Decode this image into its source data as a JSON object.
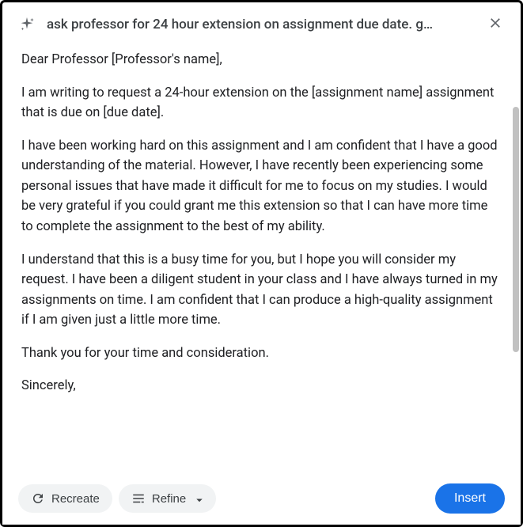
{
  "header": {
    "prompt": "ask professor for 24 hour extension on assignment due date. g…"
  },
  "content": {
    "greeting": "Dear Professor [Professor's name],",
    "para1": "I am writing to request a 24-hour extension on the [assignment name] assignment that is due on [due date].",
    "para2": "I have been working hard on this assignment and I am confident that I have a good understanding of the material. However, I have recently been experiencing some personal issues that have made it difficult for me to focus on my studies. I would be very grateful if you could grant me this extension so that I can have more time to complete the assignment to the best of my ability.",
    "para3": "I understand that this is a busy time for you, but I hope you will consider my request. I have been a diligent student in your class and I have always turned in my assignments on time. I am confident that I can produce a high-quality assignment if I am given just a little more time.",
    "para4": "Thank you for your time and consideration.",
    "closing": "Sincerely,"
  },
  "footer": {
    "recreate_label": "Recreate",
    "refine_label": "Refine",
    "insert_label": "Insert"
  }
}
